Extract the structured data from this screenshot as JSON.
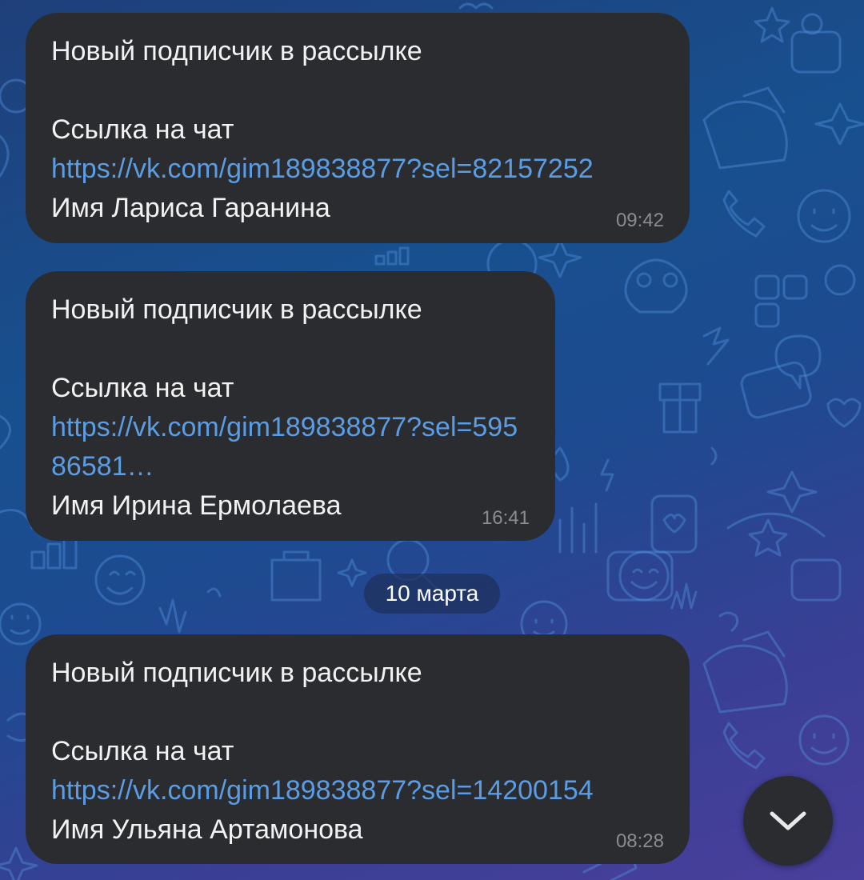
{
  "messages": [
    {
      "title": "Новый подписчик в рассылке",
      "link_label": "Ссылка на чат",
      "url": "https://vk.com/gim189838877?sel=82157252",
      "name": "Имя Лариса Гаранина",
      "time": "09:42"
    },
    {
      "title": "Новый подписчик в рассылке",
      "link_label": "Ссылка на чат",
      "url": "https://vk.com/gim189838877?sel=59586581…",
      "name": "Имя Ирина Ермолаева",
      "time": "16:41"
    },
    {
      "title": "Новый подписчик в рассылке",
      "link_label": "Ссылка на чат",
      "url": "https://vk.com/gim189838877?sel=14200154",
      "name": "Имя Ульяна Артамонова",
      "time": "08:28"
    }
  ],
  "date_separator": "10 марта",
  "icons": {
    "scroll_down": "chevron-down-icon",
    "wallpaper": "doodle-pattern"
  },
  "colors": {
    "bubble": "#2b2c30",
    "link": "#5a9de4",
    "text": "#f2f2f2",
    "time": "#8a8c92"
  }
}
